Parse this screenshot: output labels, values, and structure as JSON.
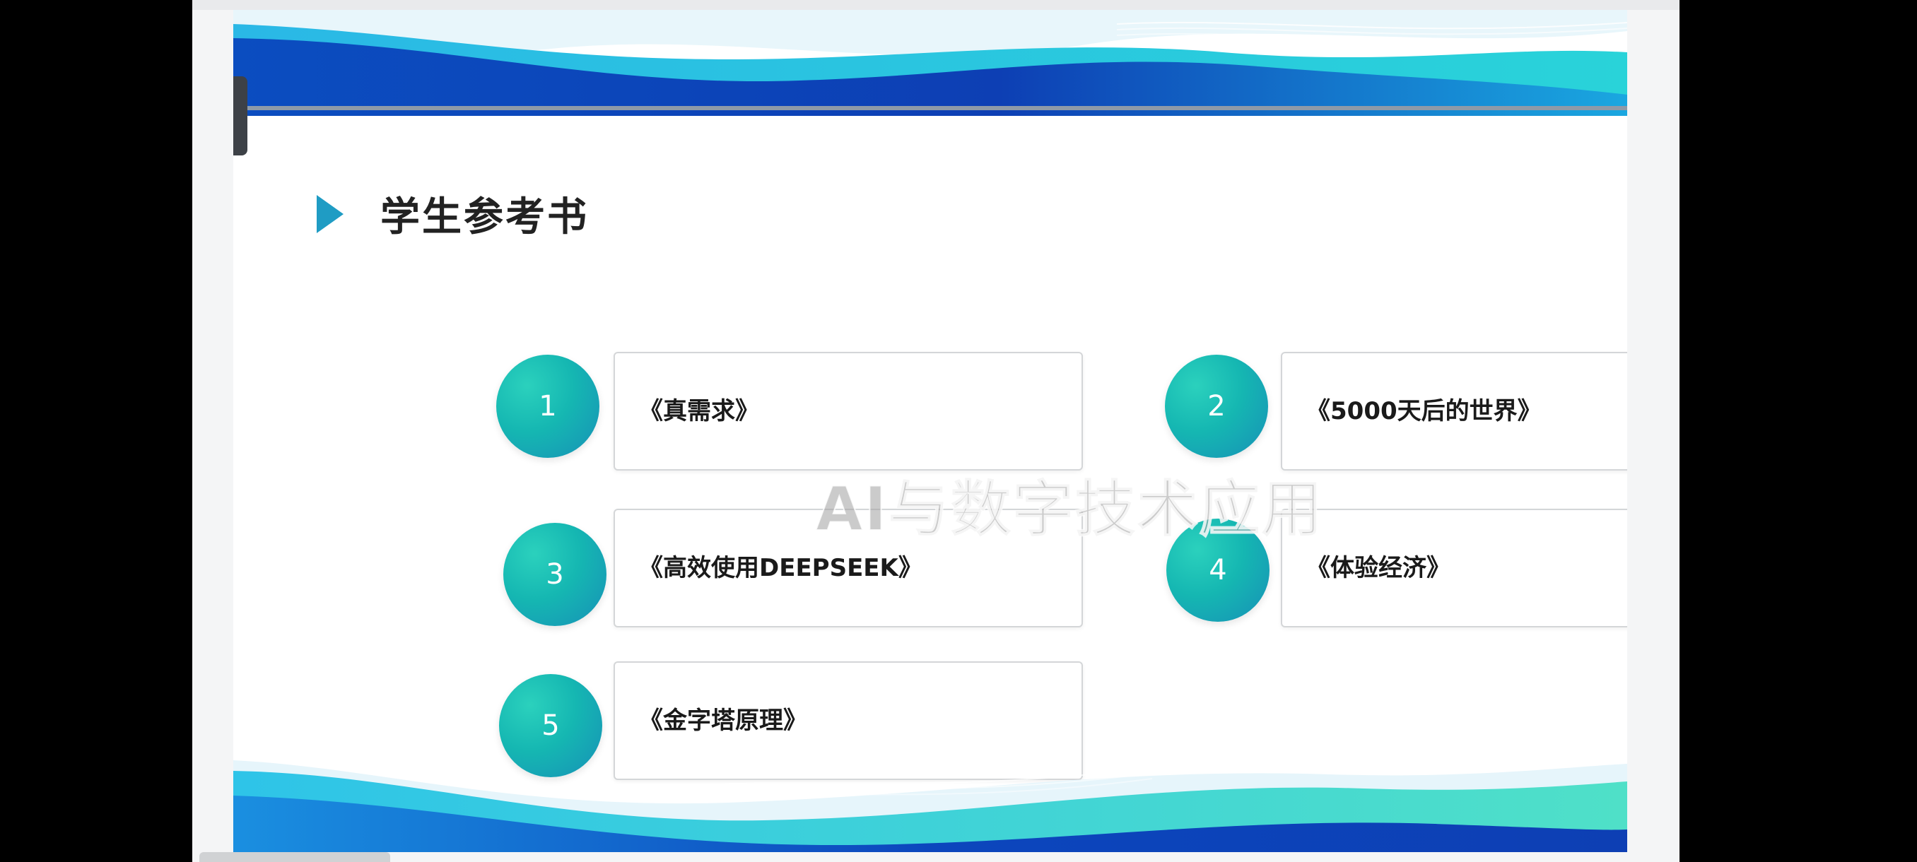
{
  "slide": {
    "heading": "学生参考书",
    "watermark": "AI与数字技术应用",
    "books": [
      {
        "number": "1",
        "title": "《真需求》"
      },
      {
        "number": "2",
        "title": "《5000天后的世界》"
      },
      {
        "number": "3",
        "title": "《高效使用DEEPSEEK》"
      },
      {
        "number": "4",
        "title": "《体验经济》"
      },
      {
        "number": "5",
        "title": "《金字塔原理》"
      }
    ]
  },
  "colors": {
    "accent_teal": "#15b7b2",
    "accent_blue": "#1790b7",
    "banner_blue": "#0d4fc0",
    "banner_cyan": "#18b7e0",
    "marker": "#1f9cc4"
  }
}
